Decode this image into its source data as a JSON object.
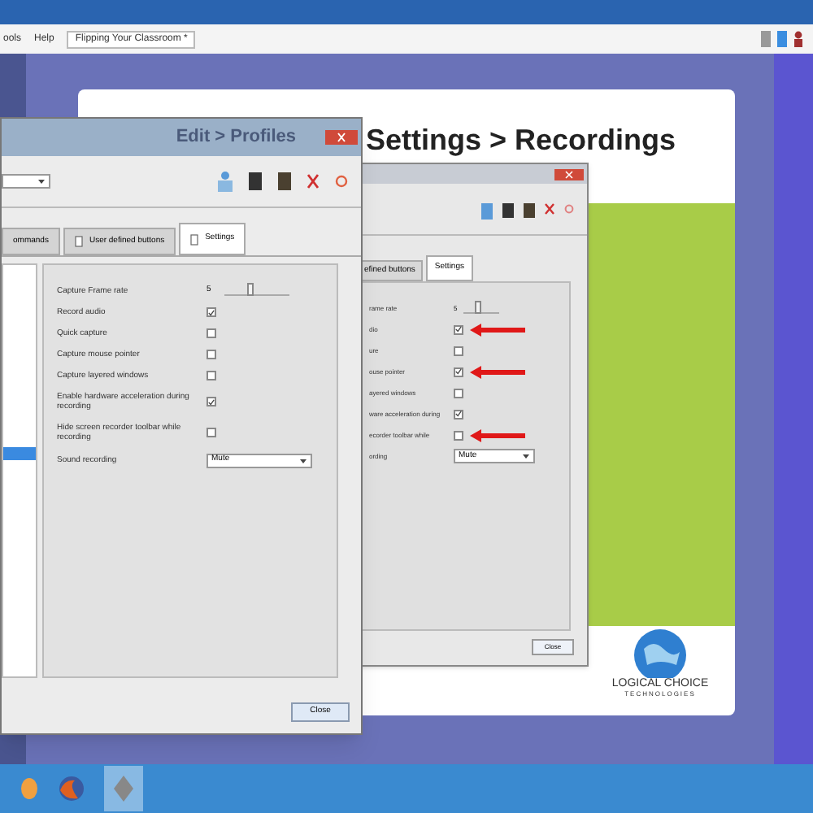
{
  "menu_bar": {
    "items": [
      "ools",
      "Help"
    ],
    "document_tab": "Flipping Your Classroom *"
  },
  "slide": {
    "title": "Settings > Recordings",
    "logo": [
      "LOGICAL CHOICE",
      "TECHNOLOGIES"
    ]
  },
  "back_dialog": {
    "tabs": [
      {
        "label": "efined buttons",
        "selected": false
      },
      {
        "label": "Settings",
        "selected": true
      }
    ],
    "settings": [
      {
        "kind": "slider",
        "label": "rame rate",
        "reading": "5",
        "level": 0.4,
        "arrow": false
      },
      {
        "kind": "checkbox",
        "label": "dio",
        "checked": true,
        "arrow": true
      },
      {
        "kind": "checkbox",
        "label": "ure",
        "checked": false,
        "arrow": false
      },
      {
        "kind": "checkbox",
        "label": "ouse pointer",
        "checked": true,
        "arrow": true
      },
      {
        "kind": "checkbox",
        "label": "ayered windows",
        "checked": false,
        "arrow": false
      },
      {
        "kind": "checkbox",
        "label": "ware acceleration during",
        "checked": true,
        "arrow": false
      },
      {
        "kind": "checkbox",
        "label": "ecorder toolbar while",
        "checked": false,
        "arrow": true
      },
      {
        "kind": "dropdown",
        "label": "ording",
        "value": "Mute",
        "arrow": false
      }
    ],
    "button": "Close"
  },
  "front_dialog": {
    "title": "Edit > Profiles",
    "tabs": [
      {
        "label": "ommands",
        "selected": false
      },
      {
        "label": "User defined buttons",
        "selected": false
      },
      {
        "label": "Settings",
        "selected": true
      }
    ],
    "settings": [
      {
        "kind": "slider",
        "label": "Capture Frame rate",
        "reading": "5",
        "level": 0.4
      },
      {
        "kind": "checkbox",
        "label": "Record audio",
        "checked": true
      },
      {
        "kind": "checkbox",
        "label": "Quick capture",
        "checked": false
      },
      {
        "kind": "checkbox",
        "label": "Capture mouse pointer",
        "checked": false
      },
      {
        "kind": "checkbox",
        "label": "Capture layered windows",
        "checked": false
      },
      {
        "kind": "checkbox",
        "label": "Enable hardware acceleration during recording",
        "checked": true
      },
      {
        "kind": "checkbox",
        "label": "Hide screen recorder toolbar while recording",
        "checked": false
      },
      {
        "kind": "dropdown",
        "label": "Sound recording",
        "value": "Mute"
      }
    ],
    "button": "Close"
  }
}
